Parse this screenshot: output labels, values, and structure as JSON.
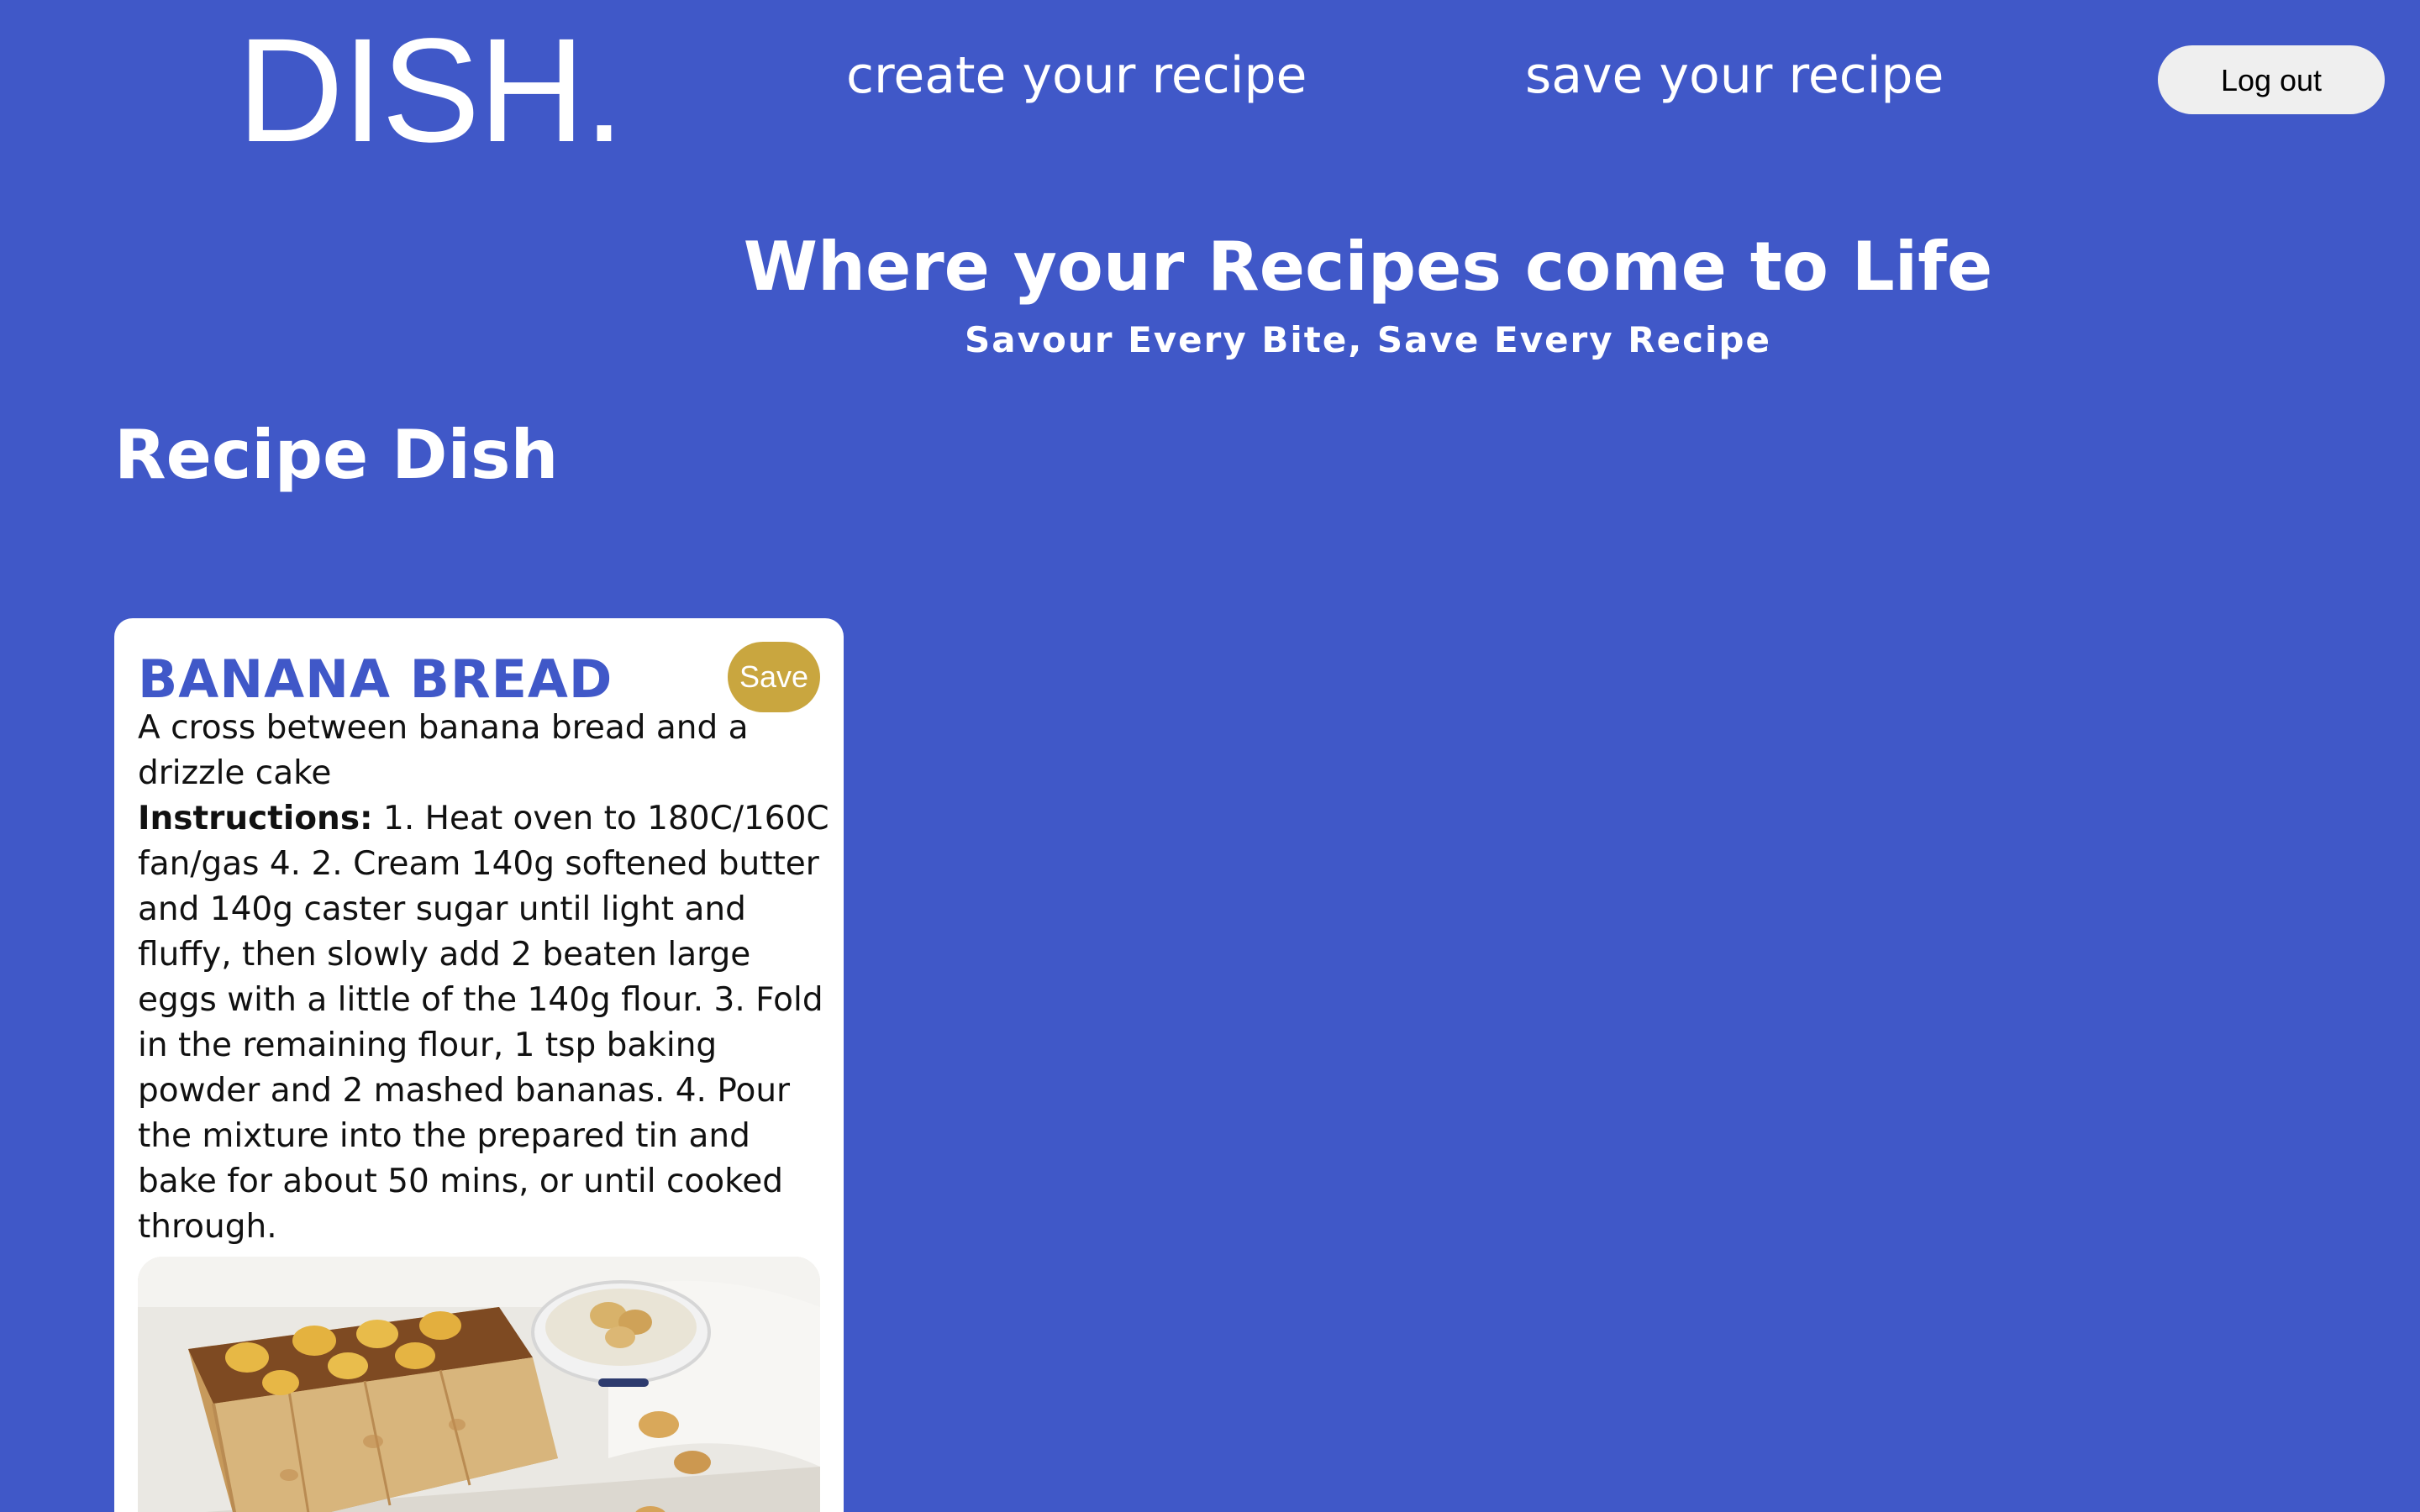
{
  "header": {
    "logo": "DISH.",
    "nav": {
      "create": "create your recipe",
      "save": "save your recipe"
    },
    "logout_label": "Log out"
  },
  "hero": {
    "title": "Where your Recipes come to Life",
    "subtitle": "Savour Every Bite, Save Every Recipe"
  },
  "section": {
    "title": "Recipe Dish"
  },
  "recipe": {
    "title": "BANANA BREAD",
    "save_label": "Save",
    "description": "A cross between banana bread and a drizzle cake",
    "instructions_label": "Instructions:",
    "instructions": " 1. Heat oven to 180C/160C fan/gas 4. 2. Cream 140g softened butter and 140g caster sugar until light and fluffy, then slowly add 2 beaten large eggs with a little of the 140g flour. 3. Fold in the remaining flour, 1 tsp baking powder and 2 mashed bananas. 4. Pour the mixture into the prepared tin and bake for about 50 mins, or until cooked through.",
    "image": "banana-bread-photo"
  },
  "colors": {
    "background": "#4058c8",
    "accent": "#c9a63f",
    "title_blue": "#4058c8"
  }
}
